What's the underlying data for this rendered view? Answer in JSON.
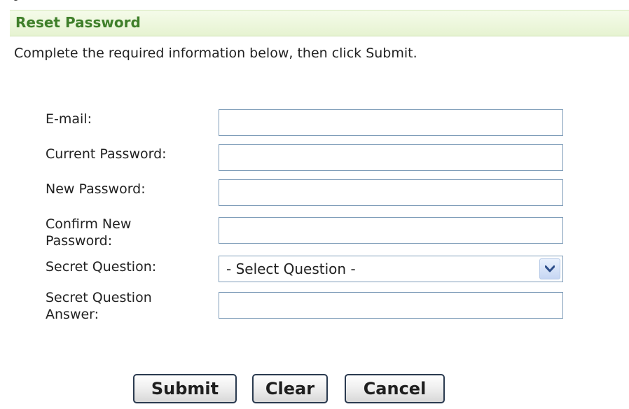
{
  "panel": {
    "title": "Reset Password",
    "instructions": "Complete the required information below, then click Submit."
  },
  "form": {
    "fields": [
      {
        "label": "E-mail:",
        "value": ""
      },
      {
        "label": "Current Password:",
        "value": ""
      },
      {
        "label": "New Password:",
        "value": ""
      },
      {
        "label": "Confirm New Password:",
        "value": ""
      },
      {
        "label": "Secret Question Answer:",
        "value": ""
      }
    ],
    "secret_question": {
      "label": "Secret Question:",
      "selected": "- Select Question -"
    }
  },
  "buttons": {
    "submit": "Submit",
    "clear": "Clear",
    "cancel": "Cancel"
  },
  "colors": {
    "header_bg": "#e6f3d1",
    "title": "#3f7f2a",
    "input_border": "#7f9db9",
    "dropdown_arrow": "#2d4e8a"
  },
  "icons": {
    "dropdown": "chevron-down-icon"
  }
}
